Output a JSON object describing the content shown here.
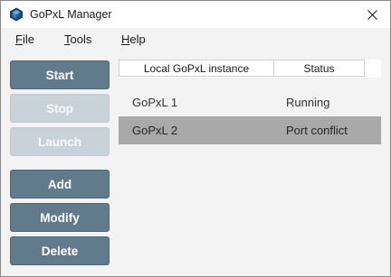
{
  "window": {
    "title": "GoPxL Manager"
  },
  "menu": {
    "items": [
      {
        "accel": "F",
        "rest": "ile"
      },
      {
        "accel": "T",
        "rest": "ools"
      },
      {
        "accel": "H",
        "rest": "elp"
      }
    ]
  },
  "buttons": {
    "start": "Start",
    "stop": "Stop",
    "launch": "Launch",
    "add": "Add",
    "modify": "Modify",
    "delete": "Delete"
  },
  "table": {
    "headers": [
      "Local GoPxL instance",
      "Status"
    ],
    "rows": [
      {
        "name": "GoPxL 1",
        "status": "Running",
        "selected": false
      },
      {
        "name": "GoPxL 2",
        "status": "Port conflict",
        "selected": true
      }
    ]
  },
  "colors": {
    "button_enabled": "#627b8c",
    "button_disabled": "#c8d3d9",
    "selected_row": "#a9a9a9"
  },
  "icons": {
    "app": "gopxl-cube-icon",
    "close": "close-icon"
  }
}
